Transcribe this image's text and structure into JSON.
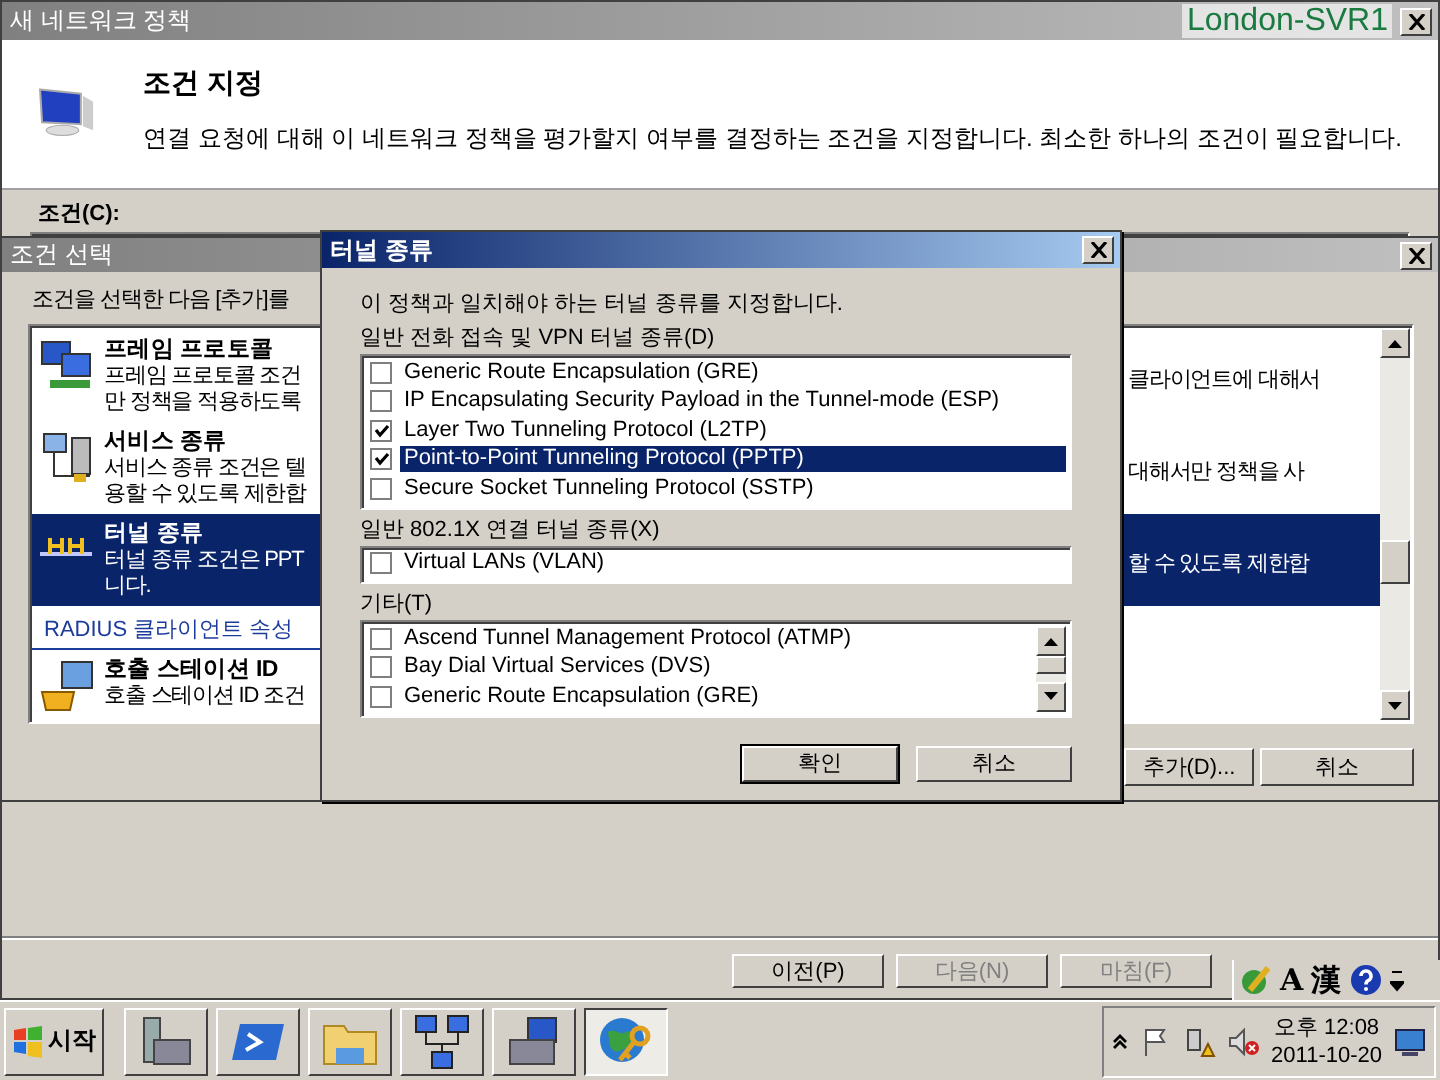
{
  "main_window": {
    "title": "새 네트워크 정책",
    "header_title": "조건 지정",
    "header_description": "연결 요청에 대해 이 네트워크 정책을 평가할지 여부를 결정하는 조건을 지정합니다. 최소한 하나의 조건이 필요합니다.",
    "conditions_label": "조건(C):",
    "buttons": [
      {
        "label": "이전(P)",
        "disabled": false
      },
      {
        "label": "다음(N)",
        "disabled": true
      },
      {
        "label": "마침(F)",
        "disabled": true
      }
    ]
  },
  "host_label": "London-SVR1",
  "condition_picker": {
    "title": "조건 선택",
    "instruction": "조건을 선택한 다음 [추가]를",
    "items": [
      {
        "kind": "condition",
        "title": "프레임 프로토콜",
        "lines": [
          "프레임 프로토콜 조건",
          "만 정책을 적용하도록"
        ],
        "right_text": "클라이언트에 대해서",
        "selected": false
      },
      {
        "kind": "condition",
        "title": "서비스 종류",
        "lines": [
          "서비스 종류 조건은 텔",
          "용할 수 있도록 제한합"
        ],
        "right_text": "대해서만 정책을 사",
        "selected": false
      },
      {
        "kind": "condition",
        "title": "터널 종류",
        "lines": [
          "터널 종류 조건은 PPT",
          "니다."
        ],
        "right_text": "할 수 있도록 제한합",
        "selected": true
      },
      {
        "kind": "group",
        "title": "RADIUS 클라이언트 속성"
      },
      {
        "kind": "condition",
        "title": "호출 스테이션 ID",
        "lines": [
          "호출 스테이션 ID 조건"
        ],
        "selected": false
      }
    ],
    "buttons": [
      "추가(D)...",
      "취소"
    ]
  },
  "tunnel_dialog": {
    "title": "터널 종류",
    "instruction": "이 정책과 일치해야 하는 터널 종류를 지정합니다.",
    "sections": [
      {
        "label": "일반 전화 접속 및 VPN 터널 종류(D)",
        "scrollable": false,
        "items": [
          {
            "label": "Generic Route Encapsulation (GRE)",
            "checked": false,
            "selected": false
          },
          {
            "label": "IP Encapsulating Security Payload in the Tunnel-mode (ESP)",
            "checked": false,
            "selected": false
          },
          {
            "label": "Layer Two Tunneling Protocol (L2TP)",
            "checked": true,
            "selected": false
          },
          {
            "label": "Point-to-Point Tunneling Protocol (PPTP)",
            "checked": true,
            "selected": true
          },
          {
            "label": "Secure Socket Tunneling Protocol (SSTP)",
            "checked": false,
            "selected": false
          }
        ]
      },
      {
        "label": "일반 802.1X 연결 터널 종류(X)",
        "scrollable": false,
        "items": [
          {
            "label": "Virtual LANs (VLAN)",
            "checked": false,
            "selected": false
          }
        ]
      },
      {
        "label": "기타(T)",
        "scrollable": true,
        "items": [
          {
            "label": "Ascend Tunnel Management Protocol (ATMP)",
            "checked": false,
            "selected": false
          },
          {
            "label": "Bay Dial Virtual Services (DVS)",
            "checked": false,
            "selected": false
          },
          {
            "label": "Generic Route Encapsulation (GRE)",
            "checked": false,
            "selected": false
          }
        ]
      }
    ],
    "buttons": [
      "확인",
      "취소"
    ]
  },
  "language_bar": {
    "mode": "A",
    "hanja": "漢"
  },
  "taskbar": {
    "start": "시작",
    "tasks": [
      {
        "selected": false
      },
      {
        "selected": false
      },
      {
        "selected": false
      },
      {
        "selected": false
      },
      {
        "selected": false
      },
      {
        "selected": true
      }
    ]
  },
  "clock": {
    "time": "오후 12:08",
    "date": "2011-10-20"
  }
}
